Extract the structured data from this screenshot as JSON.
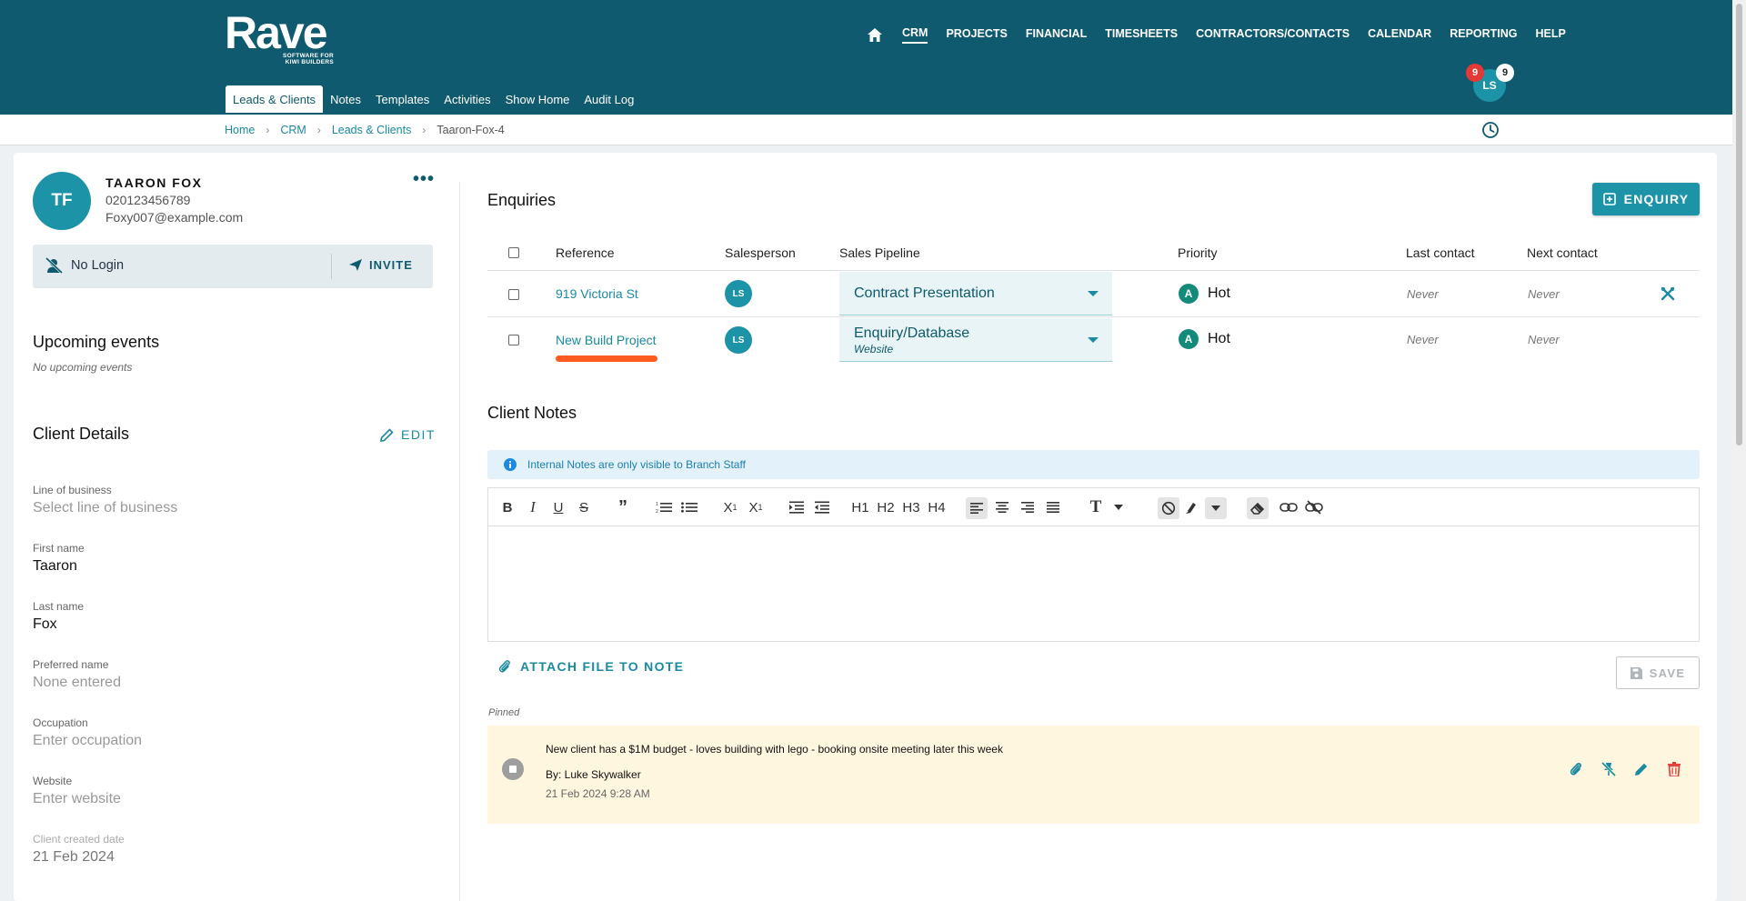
{
  "brand": {
    "name": "Rave",
    "tagline_1": "SOFTWARE FOR",
    "tagline_2": "KIWI BUILDERS"
  },
  "topnav": [
    "CRM",
    "PROJECTS",
    "FINANCIAL",
    "TIMESHEETS",
    "CONTRACTORS/CONTACTS",
    "CALENDAR",
    "REPORTING",
    "HELP"
  ],
  "subnav": [
    "Leads & Clients",
    "Notes",
    "Templates",
    "Activities",
    "Show Home",
    "Audit Log"
  ],
  "user": {
    "initials": "LS",
    "badge_red": "9",
    "badge_white": "9"
  },
  "breadcrumb": {
    "home": "Home",
    "crm": "CRM",
    "leads": "Leads & Clients",
    "current": "Taaron-Fox-4"
  },
  "client": {
    "initials": "TF",
    "name": "TAARON FOX",
    "phone": "020123456789",
    "email": "Foxy007@example.com",
    "no_login": "No Login",
    "invite": "INVITE"
  },
  "upcoming": {
    "title": "Upcoming events",
    "empty": "No upcoming events"
  },
  "details": {
    "title": "Client Details",
    "edit": "EDIT",
    "fields": [
      {
        "label": "Line of business",
        "value": "Select line of business"
      },
      {
        "label": "First name",
        "value": "Taaron"
      },
      {
        "label": "Last name",
        "value": "Fox"
      },
      {
        "label": "Preferred name",
        "value": "None entered"
      },
      {
        "label": "Occupation",
        "value": "Enter occupation"
      },
      {
        "label": "Website",
        "value": "Enter website"
      },
      {
        "label": "Client created date",
        "value": "21 Feb 2024"
      }
    ]
  },
  "enquiries": {
    "title": "Enquiries",
    "button": "ENQUIRY",
    "columns": [
      "Reference",
      "Salesperson",
      "Sales Pipeline",
      "Priority",
      "Last contact",
      "Next contact"
    ],
    "rows": [
      {
        "reference": "919 Victoria St",
        "salesperson": "LS",
        "pipeline": "Contract Presentation",
        "pipeline_sub": "",
        "priority_badge": "A",
        "priority": "Hot",
        "last_contact": "Never",
        "next_contact": "Never"
      },
      {
        "reference": "New Build Project",
        "salesperson": "LS",
        "pipeline": "Enquiry/Database",
        "pipeline_sub": "Website",
        "priority_badge": "A",
        "priority": "Hot",
        "last_contact": "Never",
        "next_contact": "Never"
      }
    ]
  },
  "notes": {
    "title": "Client Notes",
    "info": "Internal Notes are only visible to Branch Staff",
    "toolbar": {
      "h1": "H1",
      "h2": "H2",
      "h3": "H3",
      "h4": "H4",
      "text": "T"
    },
    "attach": "ATTACH FILE TO NOTE",
    "save": "SAVE",
    "pinned_label": "Pinned",
    "pinned_note": {
      "text": "New client has a $1M budget - loves building with lego - booking onsite meeting later this week",
      "by": "By: Luke Skywalker",
      "date": "21 Feb 2024 9:28 AM"
    }
  }
}
